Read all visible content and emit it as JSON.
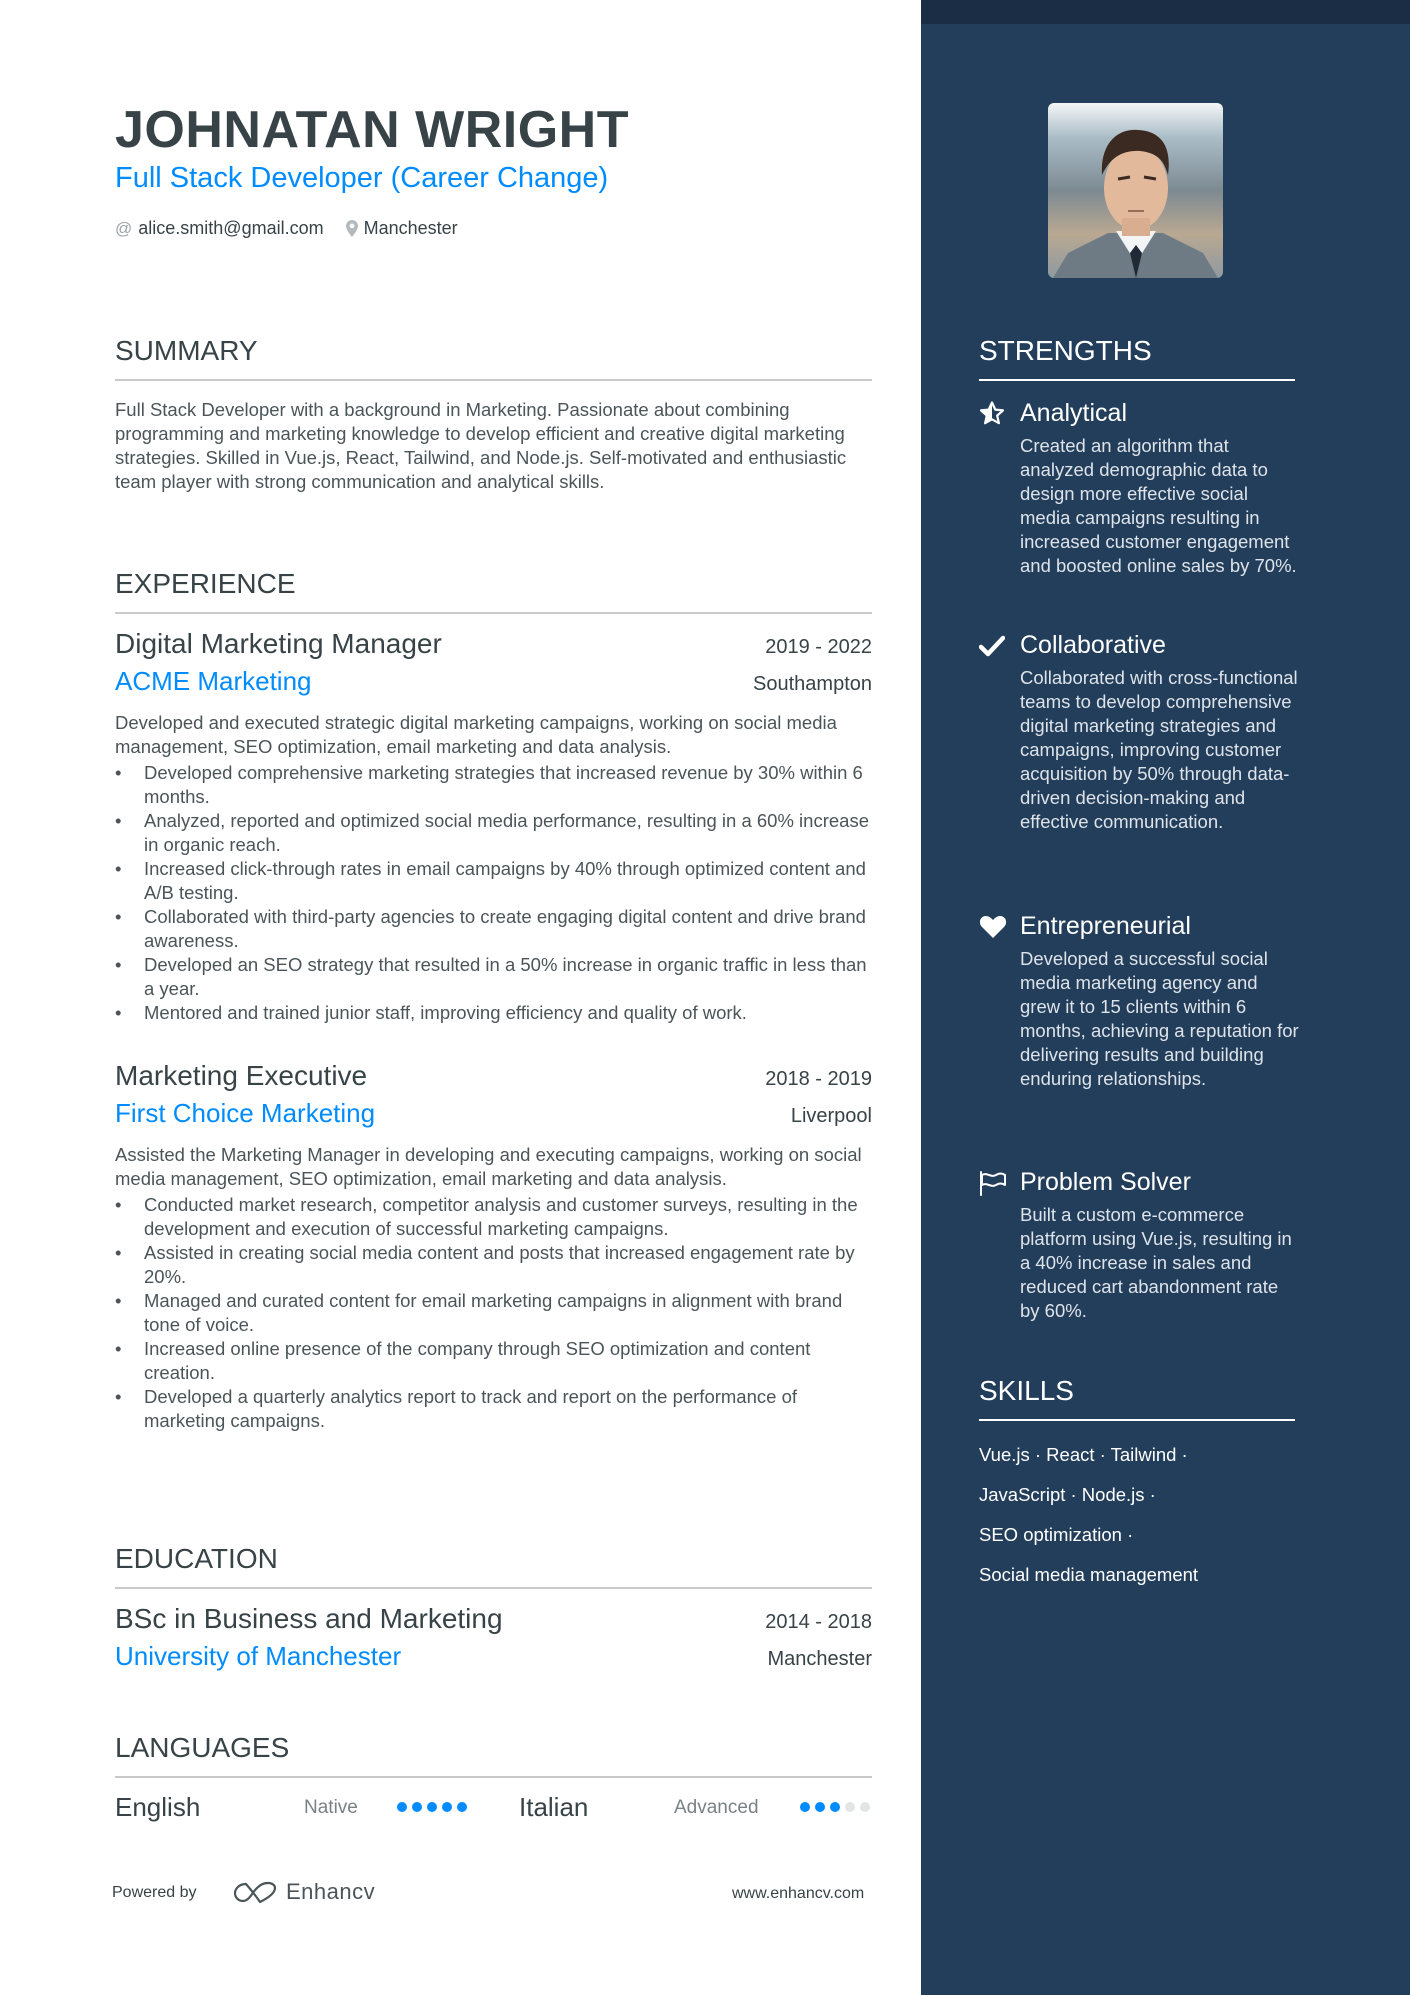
{
  "header": {
    "name": "JOHNATAN WRIGHT",
    "title": "Full Stack Developer (Career Change)",
    "email": "alice.smith@gmail.com",
    "location": "Manchester",
    "email_icon": "at-icon",
    "location_icon": "map-pin-icon"
  },
  "summary": {
    "heading": "SUMMARY",
    "text": "Full Stack Developer with a background in Marketing. Passionate about combining programming and marketing knowledge to develop efficient and creative digital marketing strategies. Skilled in Vue.js, React, Tailwind, and Node.js. Self-motivated and enthusiastic team player with strong communication and analytical skills."
  },
  "experience": {
    "heading": "EXPERIENCE",
    "jobs": [
      {
        "title": "Digital Marketing Manager",
        "dates": "2019 - 2022",
        "company": "ACME Marketing",
        "location": "Southampton",
        "description": "Developed and executed strategic digital marketing campaigns, working on social media management, SEO optimization, email marketing and data analysis.",
        "bullets": [
          "Developed comprehensive marketing strategies that increased revenue by 30% within 6 months.",
          "Analyzed, reported and optimized social media performance, resulting in a 60% increase in organic reach.",
          "Increased click-through rates in email campaigns by 40% through optimized content and A/B testing.",
          "Collaborated with third-party agencies to create engaging digital content and drive brand awareness.",
          "Developed an SEO strategy that resulted in a 50% increase in organic traffic in less than a year.",
          "Mentored and trained junior staff, improving efficiency and quality of work."
        ]
      },
      {
        "title": "Marketing Executive",
        "dates": "2018 - 2019",
        "company": "First Choice Marketing",
        "location": "Liverpool",
        "description": "Assisted the Marketing Manager in developing and executing campaigns, working on social media management, SEO optimization, email marketing and data analysis.",
        "bullets": [
          "Conducted market research, competitor analysis and customer surveys, resulting in the development and execution of successful marketing campaigns.",
          "Assisted in creating social media content and posts that increased engagement rate by 20%.",
          "Managed and curated content for email marketing campaigns in alignment with brand tone of voice.",
          "Increased online presence of the company through SEO optimization and content creation.",
          "Developed a quarterly analytics report to track and report on the performance of marketing campaigns."
        ]
      }
    ]
  },
  "education": {
    "heading": "EDUCATION",
    "degree": "BSc in Business and Marketing",
    "dates": "2014 - 2018",
    "school": "University of Manchester",
    "location": "Manchester"
  },
  "languages": {
    "heading": "LANGUAGES",
    "items": [
      {
        "name": "English",
        "level": "Native",
        "rating": 5,
        "max": 5
      },
      {
        "name": "Italian",
        "level": "Advanced",
        "rating": 3,
        "max": 5
      }
    ]
  },
  "footer": {
    "powered_by": "Powered by",
    "brand": "Enhancv",
    "url": "www.enhancv.com"
  },
  "sidebar": {
    "photo_alt": "profile-photo",
    "strengths": {
      "heading": "STRENGTHS",
      "items": [
        {
          "icon": "star-icon",
          "title": "Analytical",
          "description": "Created an algorithm that analyzed demographic data to design more effective social media campaigns resulting in increased customer engagement and boosted online sales by 70%."
        },
        {
          "icon": "check-icon",
          "title": "Collaborative",
          "description": "Collaborated with cross-functional teams to develop comprehensive digital marketing strategies and campaigns, improving customer acquisition by 50% through data-driven decision-making and effective communication."
        },
        {
          "icon": "heart-icon",
          "title": "Entrepreneurial",
          "description": "Developed a successful social media marketing agency and grew it to 15 clients within 6 months, achieving a reputation for delivering results and building enduring relationships."
        },
        {
          "icon": "flag-icon",
          "title": "Problem Solver",
          "description": "Built a custom e-commerce platform using Vue.js, resulting in a 40% increase in sales and reduced cart abandonment rate by 60%."
        }
      ]
    },
    "skills": {
      "heading": "SKILLS",
      "lines": [
        "Vue.js · React · Tailwind ·",
        "JavaScript · Node.js ·",
        "SEO optimization ·",
        "Social media management"
      ]
    }
  },
  "colors": {
    "accent": "#008cff",
    "sidebar_bg": "#233e5b",
    "sidebar_topbar": "#1b2d44",
    "text": "#384347"
  }
}
